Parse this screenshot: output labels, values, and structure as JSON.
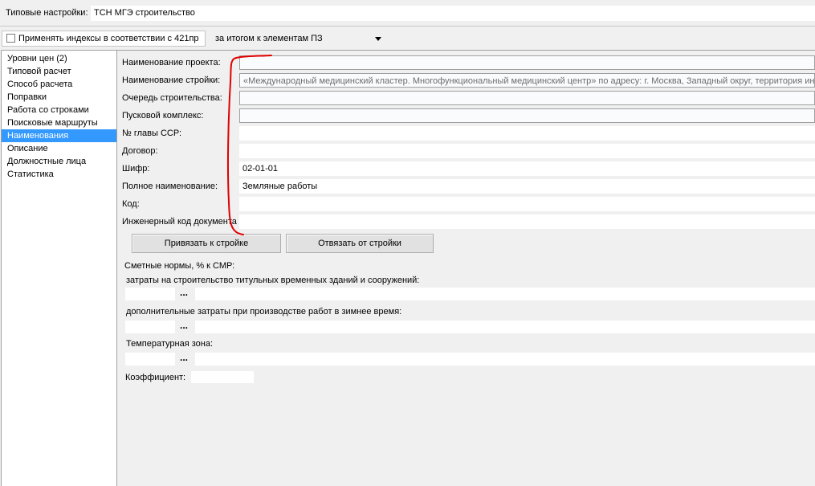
{
  "header": {
    "label": "Типовые настройки:",
    "value": "ТСН МГЭ строительство"
  },
  "toolbar": {
    "checkbox_label": "Применять индексы в соответствии с 421пр",
    "checkbox_checked": false,
    "select_value": "за итогом к элементам ПЗ"
  },
  "sidebar": {
    "items": [
      {
        "label": "Уровни цен (2)",
        "selected": false
      },
      {
        "label": "Типовой расчет",
        "selected": false
      },
      {
        "label": "Способ расчета",
        "selected": false
      },
      {
        "label": "Поправки",
        "selected": false
      },
      {
        "label": "Работа со строками",
        "selected": false
      },
      {
        "label": "Поисковые маршруты",
        "selected": false
      },
      {
        "label": "Наименования",
        "selected": true
      },
      {
        "label": "Описание",
        "selected": false
      },
      {
        "label": "Должностные лица",
        "selected": false
      },
      {
        "label": "Статистика",
        "selected": false
      }
    ]
  },
  "form": {
    "project_name": {
      "label": "Наименование проекта:",
      "value": ""
    },
    "construction_name": {
      "label": "Наименование стройки:",
      "value": "«Международный медицинский кластер. Многофункциональный медицинский центр» по адресу: г. Москва, Западный округ, территория ин"
    },
    "construction_queue": {
      "label": "Очередь строительства:",
      "value": ""
    },
    "launch_complex": {
      "label": "Пусковой комплекс:",
      "value": ""
    },
    "ssr_chapter": {
      "label": "№ главы ССР:",
      "value": ""
    },
    "contract": {
      "label": "Договор:",
      "value": ""
    },
    "cipher": {
      "label": "Шифр:",
      "value": "02-01-01"
    },
    "full_name": {
      "label": "Полное наименование:",
      "value": "Земляные работы"
    },
    "code": {
      "label": "Код:",
      "value": ""
    },
    "engineering_code": {
      "label": "Инженерный код документа",
      "value": ""
    }
  },
  "buttons": {
    "bind": "Привязать к стройке",
    "unbind": "Отвязать от стройки"
  },
  "norms": {
    "title": "Сметные нормы, % к СМР:",
    "temporary_buildings_label": "затраты на строительство титульных временных зданий и сооружений:",
    "winter_costs_label": "дополнительные затраты при производстве работ в зимнее время:",
    "temperature_zone_label": "Температурная зона:",
    "coefficient_label": "Коэффициент:",
    "dots": "..."
  },
  "colors": {
    "selection": "#3399ff",
    "annotation": "#e00000",
    "background": "#f0f0f0"
  }
}
